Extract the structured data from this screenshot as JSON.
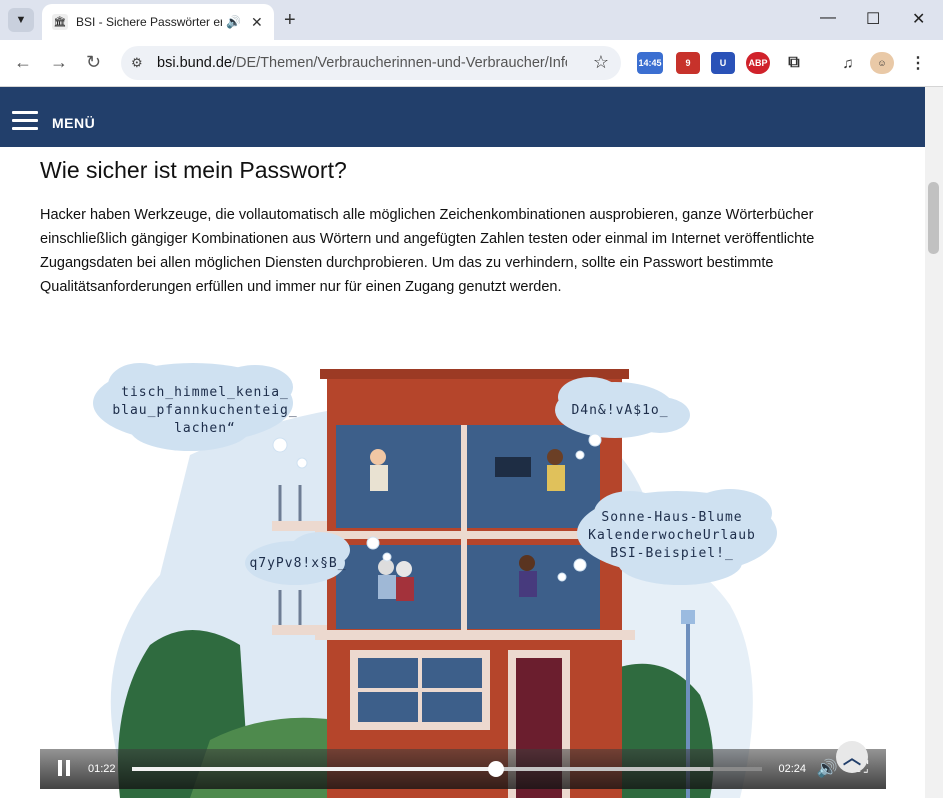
{
  "browser": {
    "tab_title": "BSI - Sichere Passwörter ers",
    "url_host": "bsi.bund.de",
    "url_path": "/DE/Themen/Verbraucherinnen-und-Verbraucher/Infor...",
    "ext_calendar_time": "14:45",
    "ext_mail_count": "9",
    "ext_abp_label": "ABP"
  },
  "site": {
    "menu_label": "MENÜ"
  },
  "article": {
    "heading": "Wie sicher ist mein Passwort?",
    "paragraph": "Hacker haben Werkzeuge, die vollautomatisch alle möglichen Zeichenkombinationen ausprobieren, ganze Wörterbücher einschließlich gängiger Kombinationen aus Wörtern und angefügten Zahlen testen oder einmal im Internet veröffentlichte Zugangsdaten bei allen möglichen Diensten durchprobieren. Um das zu verhindern, sollte ein Passwort bestimmte Qualitätsanforderungen erfüllen und immer nur für einen Zugang genutzt werden."
  },
  "illustration": {
    "bubble1": [
      "tisch_himmel_kenia_",
      "blau_pfannkuchenteig_",
      "lachen“"
    ],
    "bubble2": "D4n&!vA$1o_",
    "bubble3": "q7yPv8!x§B_",
    "bubble4": [
      "Sonne-Haus-Blume",
      "KalenderwocheUrlaub",
      "BSI-Beispiel!_"
    ]
  },
  "video": {
    "current_time": "01:22",
    "total_time": "02:24",
    "progress": 0.578,
    "buffered": 0.917
  },
  "colors": {
    "nav": "#223f6b",
    "brick": "#b5452b",
    "window": "#3d5f8a"
  }
}
